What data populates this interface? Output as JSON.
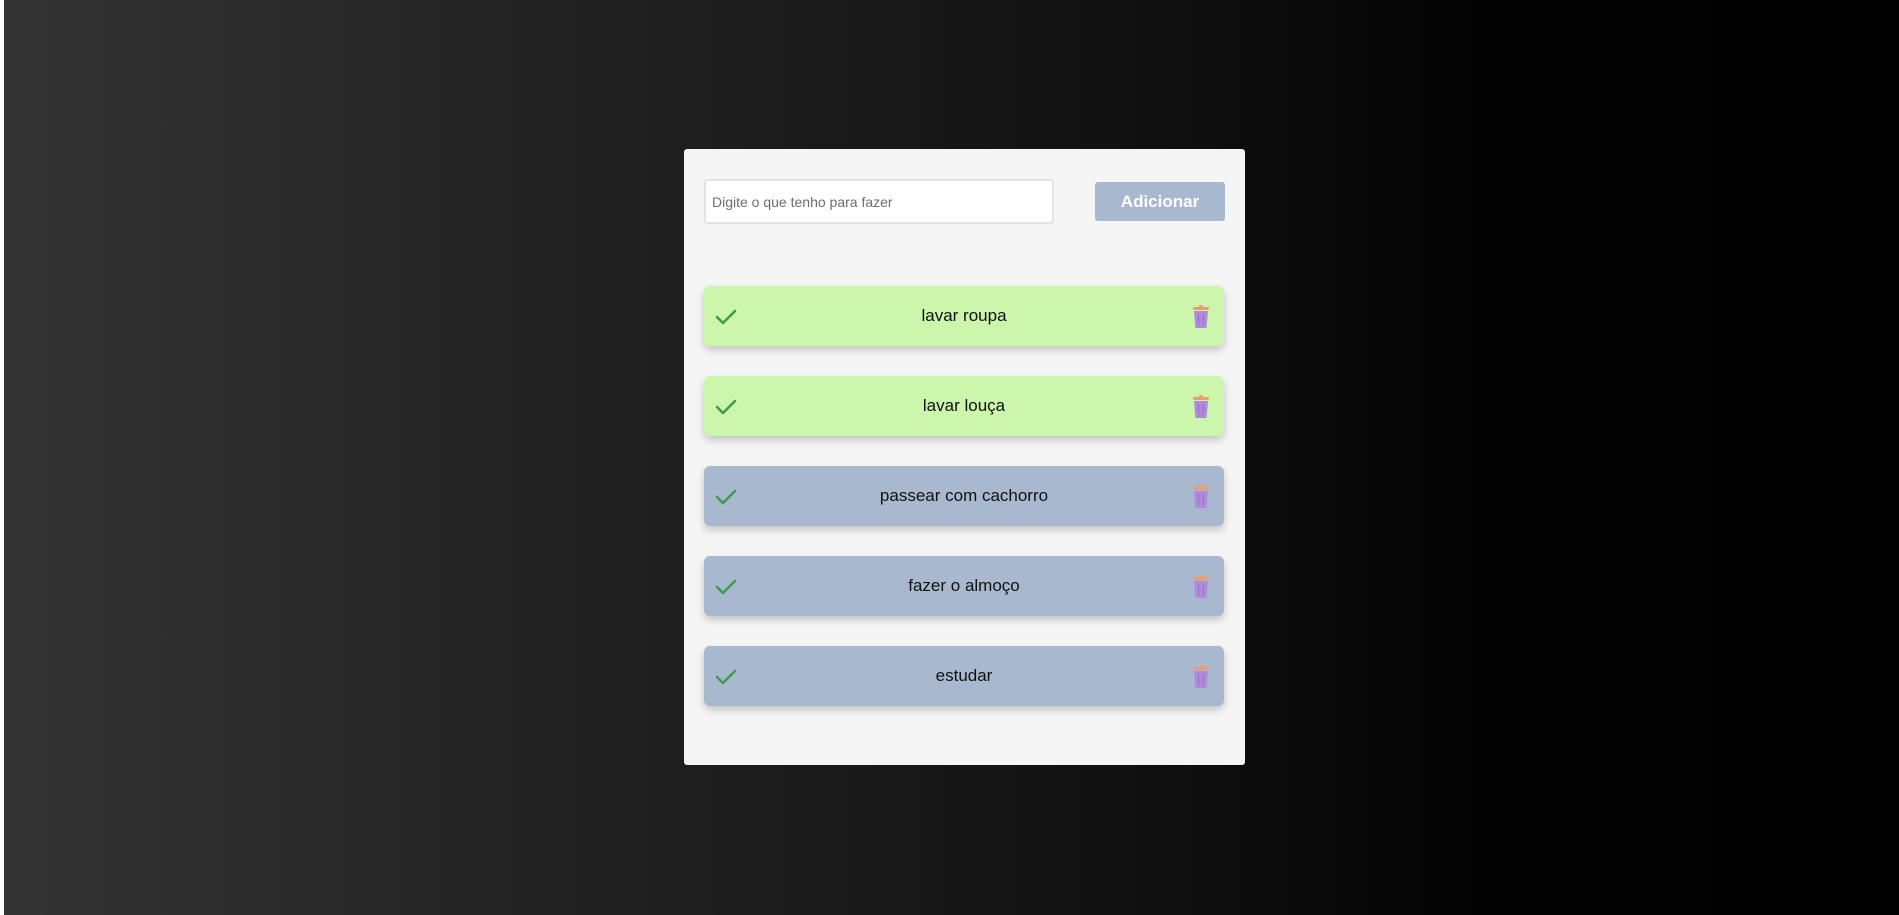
{
  "colors": {
    "done": "#cbf6ab",
    "pending": "#a8b9cf",
    "check": "#3d9b4a",
    "trash": "#b08adb"
  },
  "form": {
    "input_placeholder": "Digite o que tenho para fazer",
    "input_value": "",
    "add_label": "Adicionar"
  },
  "tasks": [
    {
      "text": "lavar roupa",
      "status": "done"
    },
    {
      "text": "lavar louça",
      "status": "done"
    },
    {
      "text": "passear com cachorro",
      "status": "pending"
    },
    {
      "text": "fazer o almoço",
      "status": "pending"
    },
    {
      "text": "estudar",
      "status": "pending"
    }
  ],
  "icons": {
    "check": "check-icon",
    "delete": "trash-icon"
  }
}
